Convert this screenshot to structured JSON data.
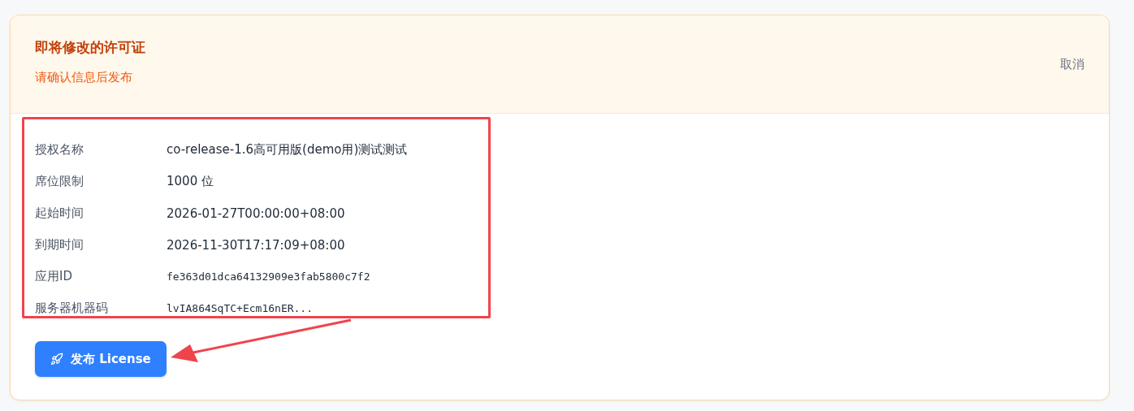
{
  "header": {
    "title": "即将修改的许可证",
    "subtitle": "请确认信息后发布",
    "cancel": "取消"
  },
  "details": [
    {
      "label": "授权名称",
      "value": "co-release-1.6高可用版(demo用)测试测试",
      "kind": "text"
    },
    {
      "label": "席位限制",
      "value": "1000 位",
      "kind": "text"
    },
    {
      "label": "起始时间",
      "value": "2026-01-27T00:00:00+08:00",
      "kind": "text"
    },
    {
      "label": "到期时间",
      "value": "2026-11-30T17:17:09+08:00",
      "kind": "text"
    },
    {
      "label": "应用ID",
      "value": "fe363d01dca64132909e3fab5800c7f2",
      "kind": "mono"
    },
    {
      "label": "服务器机器码",
      "value": "lvIA864SqTC+Ecm16nER...",
      "kind": "mono"
    }
  ],
  "publish_button": {
    "label": "发布 License"
  }
}
